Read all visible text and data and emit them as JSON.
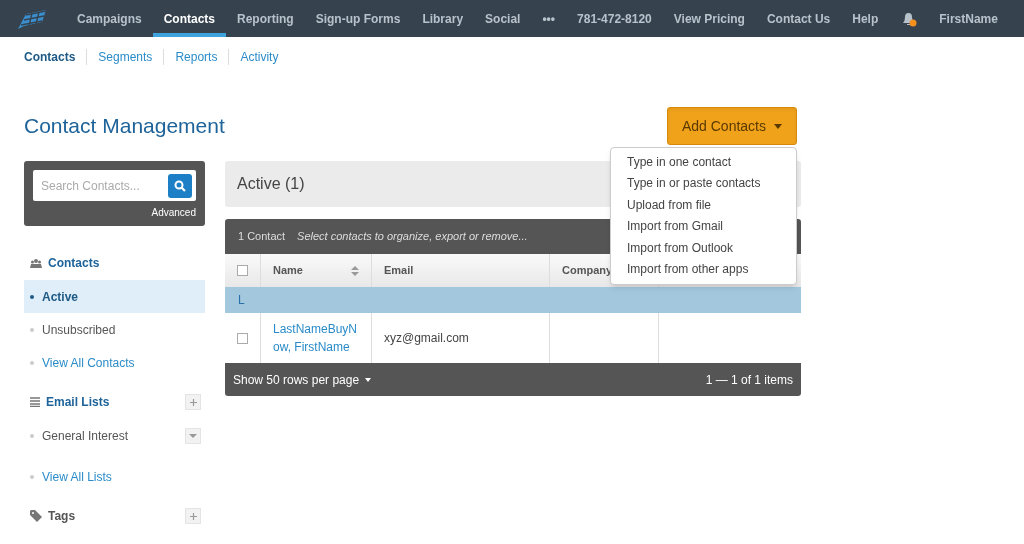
{
  "top_nav": {
    "items": [
      {
        "label": "Campaigns",
        "selected": false
      },
      {
        "label": "Contacts",
        "selected": true
      },
      {
        "label": "Reporting",
        "selected": false
      },
      {
        "label": "Sign-up Forms",
        "selected": false
      },
      {
        "label": "Library",
        "selected": false
      },
      {
        "label": "Social",
        "selected": false
      },
      {
        "label": "•••",
        "selected": false
      },
      {
        "label": "781-472-8120",
        "selected": false
      },
      {
        "label": "View Pricing",
        "selected": false
      },
      {
        "label": "Contact Us",
        "selected": false
      },
      {
        "label": "Help",
        "selected": false
      }
    ],
    "notification": true,
    "user": "FirstName"
  },
  "sub_nav": [
    {
      "label": "Contacts",
      "selected": true
    },
    {
      "label": "Segments",
      "selected": false
    },
    {
      "label": "Reports",
      "selected": false
    },
    {
      "label": "Activity",
      "selected": false
    }
  ],
  "page_title": "Contact Management",
  "add_button": {
    "label": "Add Contacts",
    "expanded": true
  },
  "add_menu": [
    "Type in one contact",
    "Type in or paste contacts",
    "Upload from file",
    "Import from Gmail",
    "Import from Outlook",
    "Import from other apps"
  ],
  "search": {
    "placeholder": "Search Contacts...",
    "advanced": "Advanced"
  },
  "sidebar": [
    {
      "title": "Contacts",
      "add": false,
      "items": [
        {
          "label": "Active",
          "kind": "status",
          "selected": true,
          "menu": false
        },
        {
          "label": "Unsubscribed",
          "kind": "status",
          "selected": false,
          "menu": false
        },
        {
          "label": "View All Contacts",
          "kind": "link",
          "selected": false,
          "menu": false
        }
      ]
    },
    {
      "title": "Email Lists",
      "add": true,
      "items": [
        {
          "label": "General Interest",
          "kind": "status",
          "selected": false,
          "menu": true
        },
        {
          "label": "View All Lists",
          "kind": "link",
          "selected": false,
          "menu": false
        }
      ]
    },
    {
      "title": "Tags",
      "add": true
    }
  ],
  "list_header": "Active (1)",
  "table": {
    "all_checked": false,
    "count": "1 Contact",
    "hint": "Select contacts to organize, export or remove...",
    "columns": [
      {
        "label": "Name",
        "sortable": true
      },
      {
        "label": "Email",
        "sortable": false
      },
      {
        "label": "Company",
        "sortable": false
      }
    ],
    "groups": [
      {
        "letter": "L",
        "rows": [
          {
            "name": "LastNameBuyNow, FirstName",
            "email": "xyz@gmail.com",
            "checked": false
          }
        ]
      }
    ],
    "page_size": "Show 50 rows per page",
    "range": "1 — 1 of 1 items"
  }
}
